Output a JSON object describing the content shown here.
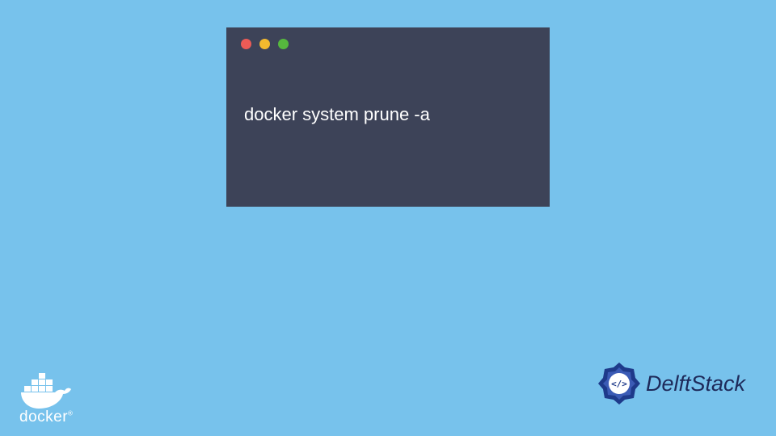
{
  "terminal": {
    "command": "docker system prune -a",
    "dots": {
      "red": "#ec5b56",
      "yellow": "#f2b92e",
      "green": "#56b83e"
    }
  },
  "logos": {
    "docker": {
      "name": "docker",
      "trademark": "®"
    },
    "delft": {
      "name": "DelftStack"
    }
  }
}
